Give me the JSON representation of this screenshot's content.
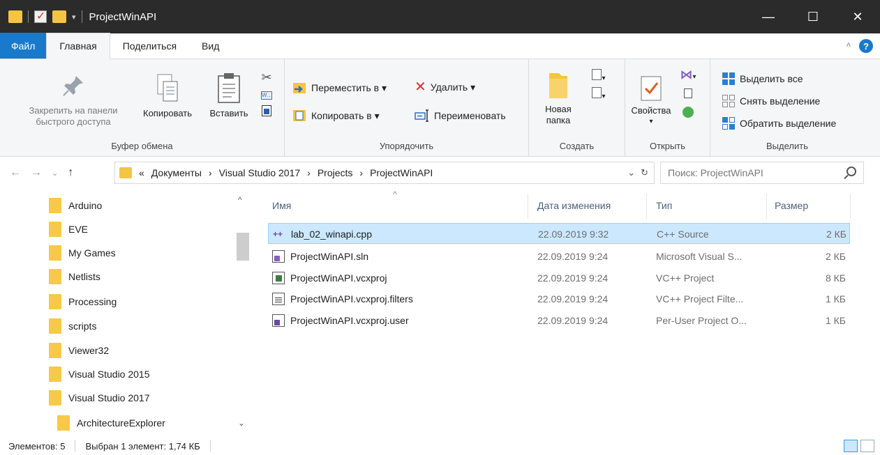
{
  "window": {
    "title": "ProjectWinAPI",
    "minimize": "—",
    "maximize": "☐",
    "close": "✕"
  },
  "tabs": [
    {
      "label": "Файл"
    },
    {
      "label": "Главная"
    },
    {
      "label": "Поделиться"
    },
    {
      "label": "Вид"
    }
  ],
  "ribbon": {
    "clipboard": {
      "pin_line1": "Закрепить на панели",
      "pin_line2": "быстрого доступа",
      "copy": "Копировать",
      "paste": "Вставить",
      "label": "Буфер обмена"
    },
    "organize": {
      "move_to": "Переместить в ▾",
      "copy_to": "Копировать в ▾",
      "delete": "Удалить ▾",
      "rename": "Переименовать",
      "label": "Упорядочить"
    },
    "new": {
      "new_folder_line1": "Новая",
      "new_folder_line2": "папка",
      "label": "Создать"
    },
    "open": {
      "properties": "Свойства",
      "properties_arrow": "▾",
      "label": "Открыть"
    },
    "select": {
      "select_all": "Выделить все",
      "select_none": "Снять выделение",
      "invert": "Обратить выделение",
      "label": "Выделить"
    }
  },
  "address": {
    "prefix": "«",
    "crumbs": [
      "Документы",
      "Visual Studio 2017",
      "Projects",
      "ProjectWinAPI"
    ],
    "separator": "›",
    "search_placeholder": "Поиск: ProjectWinAPI"
  },
  "nav_tree": [
    {
      "label": "Arduino"
    },
    {
      "label": "EVE"
    },
    {
      "label": "My Games"
    },
    {
      "label": "Netlists"
    },
    {
      "label": "Processing"
    },
    {
      "label": "scripts"
    },
    {
      "label": "Viewer32"
    },
    {
      "label": "Visual Studio 2015"
    },
    {
      "label": "Visual Studio 2017"
    },
    {
      "label": "ArchitectureExplorer"
    }
  ],
  "columns": {
    "name": "Имя",
    "date": "Дата изменения",
    "type": "Тип",
    "size": "Размер"
  },
  "files": [
    {
      "name": "lab_02_winapi.cpp",
      "date": "22.09.2019 9:32",
      "type": "C++ Source",
      "size": "2 КБ",
      "icon": "cpp-file-icon"
    },
    {
      "name": "ProjectWinAPI.sln",
      "date": "22.09.2019 9:24",
      "type": "Microsoft Visual S...",
      "size": "2 КБ",
      "icon": "sln-file-icon"
    },
    {
      "name": "ProjectWinAPI.vcxproj",
      "date": "22.09.2019 9:24",
      "type": "VC++ Project",
      "size": "8 КБ",
      "icon": "vcxproj-file-icon"
    },
    {
      "name": "ProjectWinAPI.vcxproj.filters",
      "date": "22.09.2019 9:24",
      "type": "VC++ Project Filte...",
      "size": "1 КБ",
      "icon": "filters-file-icon"
    },
    {
      "name": "ProjectWinAPI.vcxproj.user",
      "date": "22.09.2019 9:24",
      "type": "Per-User Project O...",
      "size": "1 КБ",
      "icon": "user-file-icon"
    }
  ],
  "status": {
    "items": "Элементов: 5",
    "selected": "Выбран 1 элемент: 1,74 КБ"
  },
  "colors": {
    "accent": "#1979ca",
    "selection": "#cce8ff",
    "titlebar": "#2b2b2b",
    "folder": "#f7c948"
  }
}
